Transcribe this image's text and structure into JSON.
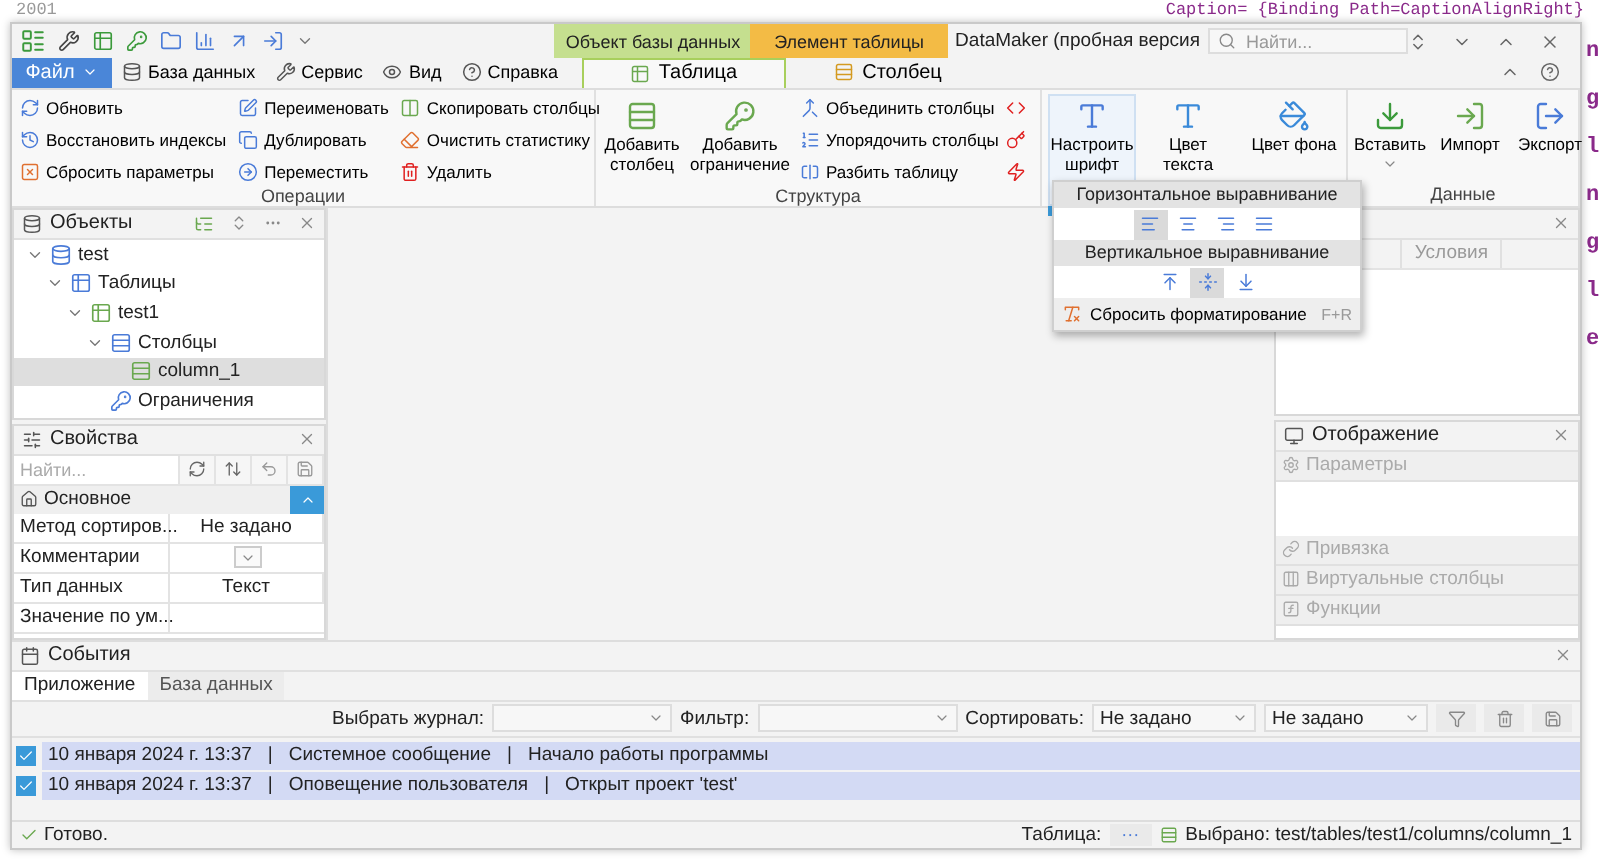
{
  "background": {
    "line_number": "2001",
    "code": "Caption= {Binding Path=CaptionAlignRight}",
    "edge_letters": [
      "n",
      "g",
      "l",
      "n",
      "g",
      "l",
      "e"
    ]
  },
  "context_tabs": [
    {
      "label": "Объект базы данных",
      "color": "#c5df8f"
    },
    {
      "label": "Элемент таблицы",
      "color": "#f3bb45"
    }
  ],
  "window": {
    "title": "DataMaker (пробная версия",
    "search": {
      "placeholder": "Найти..."
    }
  },
  "file_button": "Файл",
  "menu_tabs": [
    {
      "label": "База данных",
      "kind": "database"
    },
    {
      "label": "Сервис",
      "kind": "tools"
    },
    {
      "label": "Вид",
      "kind": "view"
    },
    {
      "label": "Справка",
      "kind": "help"
    }
  ],
  "ribbon_tabs": [
    {
      "label": "Таблица",
      "selected": true,
      "kind": "table"
    },
    {
      "label": "Столбец",
      "selected": false,
      "kind": "column"
    }
  ],
  "operations": {
    "title": "Операции",
    "items": [
      {
        "label": "Обновить",
        "kind": "refresh"
      },
      {
        "label": "Восстановить индексы",
        "kind": "restore"
      },
      {
        "label": "Сбросить параметры",
        "kind": "reset"
      },
      {
        "label": "Переименовать",
        "kind": "rename"
      },
      {
        "label": "Дублировать",
        "kind": "duplicate"
      },
      {
        "label": "Переместить",
        "kind": "move"
      },
      {
        "label": "Скопировать столбцы",
        "kind": "copy"
      },
      {
        "label": "Очистить статистику",
        "kind": "clear"
      },
      {
        "label": "Удалить",
        "kind": "delete"
      }
    ]
  },
  "structure": {
    "title": "Структура",
    "big_buttons": [
      {
        "label": "Добавить столбец",
        "kind": "column"
      },
      {
        "label": "Добавить ограничение",
        "kind": "key"
      }
    ],
    "items": [
      {
        "label": "Объединить столбцы",
        "kind": "merge"
      },
      {
        "label": "Упорядочить столбцы",
        "kind": "order"
      },
      {
        "label": "Разбить таблицу",
        "kind": "split"
      }
    ]
  },
  "format": {
    "buttons": [
      {
        "label": "Настроить шрифт",
        "selected": true,
        "kind": "font"
      },
      {
        "label": "Цвет текста",
        "selected": false,
        "kind": "text-color"
      },
      {
        "label": "Цвет фона",
        "selected": false,
        "kind": "fill"
      }
    ]
  },
  "data_group": {
    "title": "Данные",
    "buttons": [
      {
        "label": "Вставить",
        "kind": "insert"
      },
      {
        "label": "Импорт",
        "kind": "import"
      },
      {
        "label": "Экспорт",
        "kind": "export"
      }
    ]
  },
  "format_popup": {
    "horizontal_title": "Горизонтальное выравнивание",
    "horizontal": [
      {
        "kind": "left",
        "selected": true
      },
      {
        "kind": "center",
        "selected": false
      },
      {
        "kind": "right",
        "selected": false
      },
      {
        "kind": "justify",
        "selected": false
      }
    ],
    "vertical_title": "Вертикальное выравнивание",
    "vertical": [
      {
        "kind": "top",
        "selected": false
      },
      {
        "kind": "middle",
        "selected": true
      },
      {
        "kind": "bottom",
        "selected": false
      }
    ],
    "reset": {
      "label": "Сбросить форматирование",
      "shortcut": "F+R"
    }
  },
  "objects": {
    "title": "Объекты",
    "tree": [
      {
        "label": "test",
        "kind": "database",
        "expanded": true,
        "selected": false,
        "children": [
          {
            "label": "Таблицы",
            "kind": "tables",
            "expanded": true,
            "selected": false,
            "children": [
              {
                "label": "test1",
                "kind": "table",
                "expanded": true,
                "selected": false,
                "children": [
                  {
                    "label": "Столбцы",
                    "kind": "columns",
                    "expanded": true,
                    "selected": false,
                    "children": [
                      {
                        "label": "column_1",
                        "kind": "column",
                        "selected": true
                      }
                    ]
                  },
                  {
                    "label": "Ограничения",
                    "kind": "constraints",
                    "selected": false
                  }
                ]
              }
            ]
          }
        ]
      }
    ]
  },
  "properties": {
    "title": "Свойства",
    "search": {
      "placeholder": "Найти..."
    },
    "category": {
      "label": "Основное",
      "expanded": true
    },
    "rows": [
      {
        "name": "Метод сортиров...",
        "value": "Не задано",
        "kind": "text"
      },
      {
        "name": "Комментарии",
        "kind": "dropdown"
      },
      {
        "name": "Тип данных",
        "value": "Текст",
        "kind": "text"
      },
      {
        "name": "Значение по ум...",
        "kind": "text"
      }
    ]
  },
  "conditions_panel": {
    "tabs": [
      {
        "label": "Условия",
        "selected": false
      }
    ]
  },
  "display_panel": {
    "title": "Отображение",
    "sections": [
      {
        "label": "Параметры",
        "kind": "settings",
        "disabled": true
      },
      {
        "label": "Привязка",
        "kind": "link",
        "disabled": true
      },
      {
        "label": "Виртуальные столбцы",
        "kind": "columns",
        "disabled": true
      },
      {
        "label": "Функции",
        "kind": "function",
        "disabled": true
      }
    ]
  },
  "events": {
    "title": "События",
    "tabs": [
      {
        "label": "Приложение",
        "selected": true
      },
      {
        "label": "База данных",
        "selected": false
      }
    ],
    "filters": [
      {
        "label": "Выбрать журнал:"
      },
      {
        "label": "Фильтр:"
      },
      {
        "label": "Сортировать:",
        "value": "Не задано"
      },
      {
        "value": "Не задано"
      }
    ],
    "separator": "|",
    "rows": [
      {
        "checked": true,
        "date": "10 января 2024 г. 13:37",
        "source": "Системное сообщение",
        "message": "Начало работы программы"
      },
      {
        "checked": true,
        "date": "10 января 2024 г. 13:37",
        "source": "Оповещение пользователя",
        "message": "Открыт проект 'test'"
      }
    ]
  },
  "status": {
    "text": "Готово.",
    "table_label": "Таблица:",
    "table_button": "···",
    "selected": "Выбрано: test/tables/test1/columns/column_1"
  }
}
